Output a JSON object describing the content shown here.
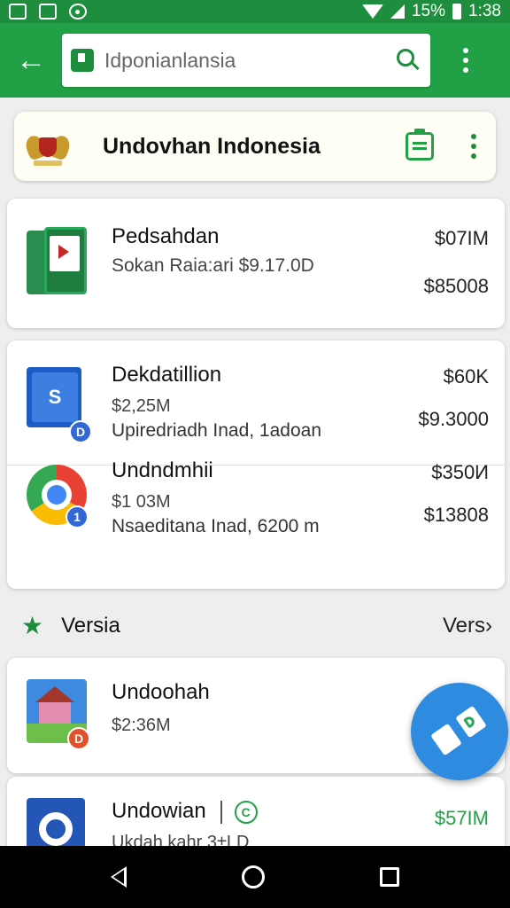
{
  "status_bar": {
    "battery": "15%",
    "time": "1:38"
  },
  "app_bar": {
    "search_text": "Idponianlansia"
  },
  "header_card": {
    "title": "Undovhan Indonesia"
  },
  "card1": {
    "name": "Pedsahdan",
    "subtitle": "Sokan Raia:ari  $9.17.0D",
    "price_top": "$07IM",
    "price_bottom": "$85008"
  },
  "card2": {
    "rows": [
      {
        "name": "Dekdatillion",
        "sub": "$2,25M",
        "sub2": "Upiredriadh Inad, 1adoan",
        "price_top": "$60K",
        "price_bottom": "$9.3000",
        "thumb_letter": "S",
        "badge": "D"
      },
      {
        "name": "Undndmhii",
        "sub": "$1 03M",
        "sub2": "Nsaeditana Inad, 6200 m",
        "price_top": "$350И",
        "price_bottom": "$13808",
        "badge": "1"
      }
    ]
  },
  "section": {
    "title": "Versia",
    "more": "Vers›"
  },
  "card3": {
    "name": "Undoohah",
    "sub": "$2:36M",
    "badge": "D"
  },
  "card4": {
    "name": "Undowian",
    "sub": "Ukdah kahr 3±LD",
    "price": "$57IM",
    "badge": "C"
  },
  "colors": {
    "primary": "#22a046",
    "accent": "#2f8be0"
  }
}
